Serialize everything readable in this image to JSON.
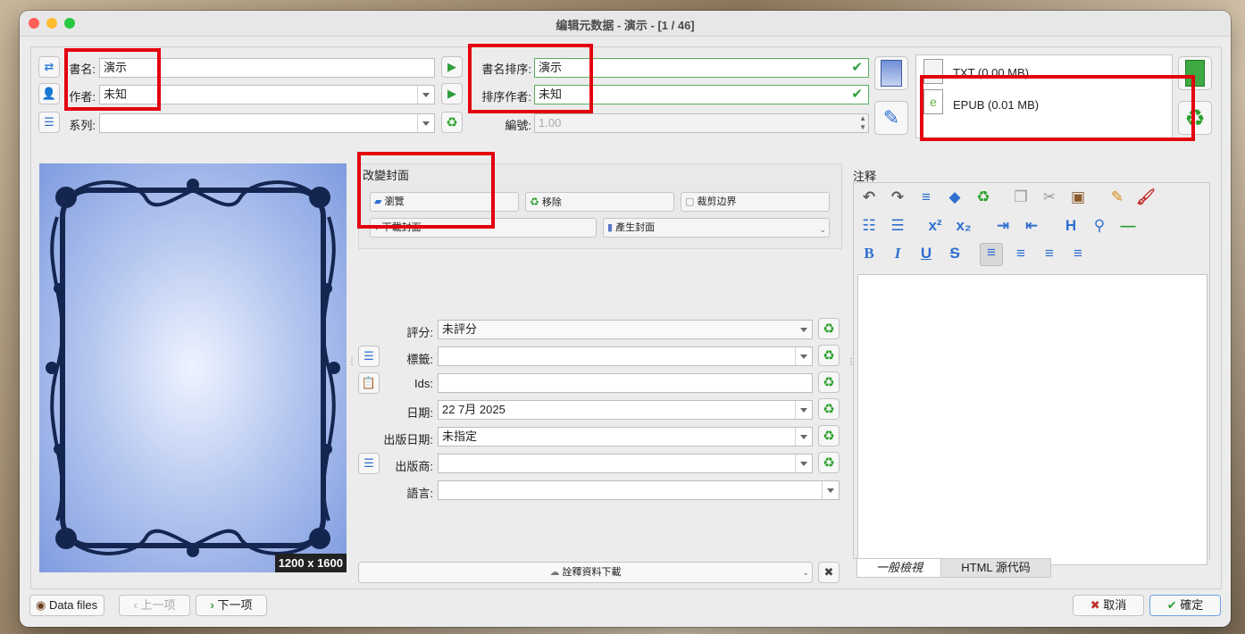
{
  "window": {
    "title": "编辑元数据 - 演示 - [1 / 46]"
  },
  "fields": {
    "title_label": "書名:",
    "title_value": "演示",
    "author_label": "作者:",
    "author_value": "未知",
    "series_label": "系列:",
    "series_value": "",
    "title_sort_label": "書名排序:",
    "title_sort_value": "演示",
    "author_sort_label": "排序作者:",
    "author_sort_value": "未知",
    "number_label": "編號:",
    "number_value": "1.00"
  },
  "formats": [
    {
      "name": "TXT (0.00 MB)",
      "icon": "txt-file-icon"
    },
    {
      "name": "EPUB (0.01 MB)",
      "icon": "epub-file-icon"
    }
  ],
  "cover": {
    "size_label": "1200 x 1600"
  },
  "change_cover": {
    "heading": "改變封面",
    "browse": "瀏覽",
    "remove": "移除",
    "trim": "裁剪边界",
    "download": "下載封面",
    "generate": "產生封面"
  },
  "metadata": {
    "rating_label": "評分:",
    "rating_value": "未評分",
    "tags_label": "標籤:",
    "tags_value": "",
    "ids_label": "Ids:",
    "ids_value": "",
    "date_label": "日期:",
    "date_value": "22 7月 2025",
    "pubdate_label": "出版日期:",
    "pubdate_value": "未指定",
    "publisher_label": "出版商:",
    "publisher_value": "",
    "language_label": "語言:",
    "language_value": ""
  },
  "download_button": "詮釋資料下載",
  "comments": {
    "heading": "注释",
    "tab_normal": "一般檢視",
    "tab_html": "HTML 源代码"
  },
  "footer": {
    "data_files": "Data files",
    "prev": "上一项",
    "next": "下一项",
    "cancel": "取消",
    "ok": "確定"
  },
  "colors": {
    "accent_green": "#2e9e3c",
    "highlight_red": "#e3000f",
    "cover_blue": "#8fa7e0"
  }
}
